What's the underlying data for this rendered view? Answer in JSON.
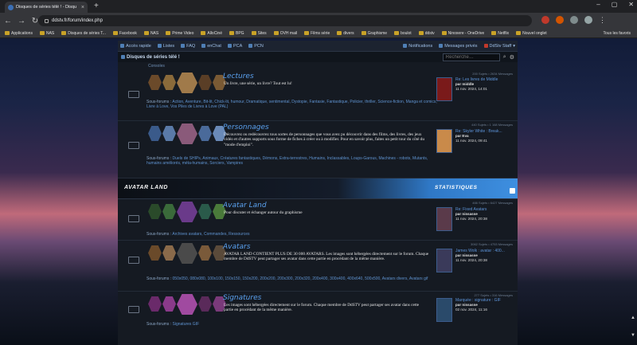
{
  "browser": {
    "tab_title": "Disques de séries télé ! - Disqu",
    "url": "ddstv.fr/forum/index.php",
    "bookmarks": [
      "Applications",
      "NAS",
      "Disques de séries T...",
      "Facebook",
      "NAS",
      "Prime Video",
      "AlloCiné",
      "BPG",
      "Sites",
      "OVH mail",
      "Films série",
      "divers",
      "Graphisme",
      "boulot",
      "ddstv",
      "Ninoxere - OneDrive",
      "Netflix",
      "Nouvel onglet"
    ],
    "all_bookmarks": "Tous les favoris"
  },
  "forum": {
    "nav": {
      "items": [
        "Accès rapide",
        "Listes",
        "FAQ",
        "enChat",
        "PCA",
        "PCN"
      ],
      "notifications": "Notifications",
      "messages": "Messages privés",
      "user": "DdStv Staff"
    },
    "breadcrumb": "Disques de séries télé !",
    "search_placeholder": "Recherche…",
    "consoles": "Consoles",
    "rows": [
      {
        "title": "Lectures",
        "desc": "Un livre, une série, un livre? Tout est lu!",
        "subs_label": "Sous-forums :",
        "subs": "Action, Aventure, Bit-lit, Chick-lit, humour, Dramatique, sentimental, Dystopie, Fantasie, Fantastique, Policier, thriller, Science-fiction, Manga et comics, Livre à Love, Vos Piles de Livres à Love (PAL)",
        "stats": "200 Sujets • 2634 Messages",
        "last_title": "Re: Les livres de Middle",
        "last_by": "par middle",
        "last_date": "11 nov. 2024, 14:01"
      },
      {
        "title": "Personnages",
        "desc": "Découvrez ou redécouvrez tous sortes de personnages que vous avez pu découvrir dans des films, des livres, des jeux vidéo et d'autres supports sous forme de fiches à créer ou à modifier. Pour en savoir plus, faites un petit tour du côté du \"mode d'emploi\".",
        "subs_label": "Sous-forums :",
        "subs": "Duels de SHIPs, Animaux, Créatures fantastiques, Démons, Extra-terrestres, Humains, Inclassables, Loups-Garous, Machines - robots, Mutants, humains améliorés, méta-humains, Sorciers, Vampires",
        "stats": "440 Sujets • 1 168 Messages",
        "last_title": "Re: Skyler White : Break...",
        "last_by": "par Eva",
        "last_date": "11 nov. 2024, 09:41"
      },
      {
        "title": "Avatar Land",
        "desc": "Pour discuter et échanger autour du graphisme",
        "subs_label": "Sous-forums :",
        "subs": "Archives avatars, Commandes, Ressources",
        "stats": "466 Sujets • 6427 Messages",
        "last_title": "Re: Fixed Avatars",
        "last_by": "par nissasse",
        "last_date": "11 nov. 2024, 20:38"
      },
      {
        "title": "Avatars",
        "desc": "AVATAR LAND CONTIENT PLUS DE 30 000 AVATARS. Les images sont hébergées directement sur le forum. Chaque membre de DdSTV peut partager ses avatar dans cette partie en procédant de la même manière.",
        "subs_label": "Sous-forums :",
        "subs": "050x050, 080x080, 100x100, 150x150, 150x200, 200x200, 200x300, 200x320, 200x400, 300x400, 400x640, 500x500, Avatars divers, Avatars gif",
        "stats": "3062 Sujets • 4753 Messages",
        "last_title": "James Wolk : avatar : 400...",
        "last_by": "par nissasse",
        "last_date": "11 nov. 2024, 20:38"
      },
      {
        "title": "Signatures",
        "desc": "Les images sont hébergées directement sur le forum. Chaque membre de DdSTV peut partager ses avatar dans cette partie en procédant de la même manière.",
        "subs_label": "Sous-forums :",
        "subs": "Signatures GIF",
        "stats": "277 Sujets • 316 Messages",
        "last_title": "Marquée : signature : GIF",
        "last_by": "par nissasse",
        "last_date": "02 nov. 2024, 11:16"
      }
    ],
    "category": {
      "title": "AVATAR LAND",
      "stats": "STATISTIQUES"
    }
  },
  "colors": {
    "accent": "#5aa0ee",
    "page_bg": "#151a22",
    "header_gradient": "#3e8fe0"
  }
}
